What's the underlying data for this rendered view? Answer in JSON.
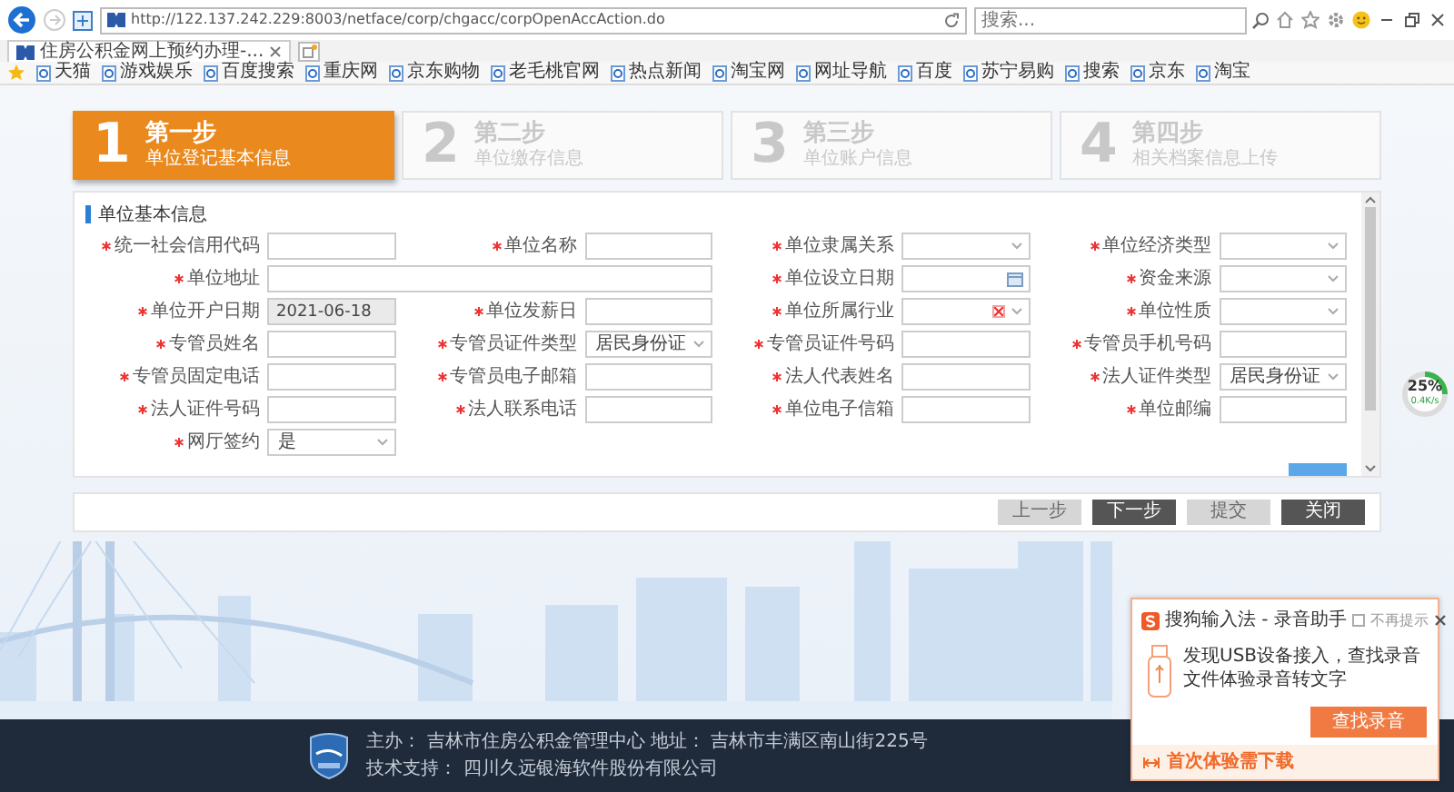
{
  "browser": {
    "address_bar": {
      "url": "http://122.137.242.229:8003/netface/corp/chgacc/corpOpenAccAction.do"
    },
    "search": {
      "placeholder": "搜索..."
    },
    "tabs": [
      {
        "title": "住房公积金网上预约办理-...",
        "selected": true
      }
    ],
    "bookmarks": [
      "天猫",
      "游戏娱乐",
      "百度搜索",
      "重庆网",
      "京东购物",
      "老毛桃官网",
      "热点新闻",
      "淘宝网",
      "网址导航",
      "百度",
      "苏宁易购",
      "搜索",
      "京东",
      "淘宝"
    ]
  },
  "steps": [
    {
      "number": "1",
      "title": "第一步",
      "subtitle": "单位登记基本信息",
      "selected": true
    },
    {
      "number": "2",
      "title": "第二步",
      "subtitle": "单位缴存信息",
      "selected": false
    },
    {
      "number": "3",
      "title": "第三步",
      "subtitle": "单位账户信息",
      "selected": false
    },
    {
      "number": "4",
      "title": "第四步",
      "subtitle": "相关档案信息上传",
      "selected": false
    }
  ],
  "form": {
    "section_title": "单位基本信息",
    "fields": [
      {
        "label": "统一社会信用代码",
        "required": true,
        "kind": "text"
      },
      {
        "label": "单位名称",
        "required": true,
        "kind": "text"
      },
      {
        "label": "单位隶属关系",
        "required": true,
        "kind": "select"
      },
      {
        "label": "单位经济类型",
        "required": true,
        "kind": "select"
      },
      {
        "label": "单位地址",
        "required": true,
        "kind": "text",
        "wide": true
      },
      {
        "label": "单位设立日期",
        "required": true,
        "kind": "date"
      },
      {
        "label": "资金来源",
        "required": true,
        "kind": "select"
      },
      {
        "label": "单位开户日期",
        "required": true,
        "kind": "text",
        "value": "2021-06-18",
        "disabled": true
      },
      {
        "label": "单位发薪日",
        "required": true,
        "kind": "text"
      },
      {
        "label": "单位所属行业",
        "required": true,
        "kind": "select",
        "clearable": true
      },
      {
        "label": "单位性质",
        "required": true,
        "kind": "select"
      },
      {
        "label": "专管员姓名",
        "required": true,
        "kind": "text"
      },
      {
        "label": "专管员证件类型",
        "required": true,
        "kind": "select",
        "value": "居民身份证"
      },
      {
        "label": "专管员证件号码",
        "required": true,
        "kind": "text"
      },
      {
        "label": "专管员手机号码",
        "required": true,
        "kind": "text"
      },
      {
        "label": "专管员固定电话",
        "required": true,
        "kind": "text"
      },
      {
        "label": "专管员电子邮箱",
        "required": true,
        "kind": "text"
      },
      {
        "label": "法人代表姓名",
        "required": true,
        "kind": "text"
      },
      {
        "label": "法人证件类型",
        "required": true,
        "kind": "select",
        "value": "居民身份证"
      },
      {
        "label": "法人证件号码",
        "required": true,
        "kind": "text"
      },
      {
        "label": "法人联系电话",
        "required": true,
        "kind": "text"
      },
      {
        "label": "单位电子信箱",
        "required": true,
        "kind": "text"
      },
      {
        "label": "单位邮编",
        "required": true,
        "kind": "text"
      },
      {
        "label": "网厅签约",
        "required": true,
        "kind": "select",
        "value": "是"
      }
    ]
  },
  "buttons": [
    {
      "label": "上一步",
      "disabled": true
    },
    {
      "label": "下一步",
      "disabled": false
    },
    {
      "label": "提交",
      "disabled": true
    },
    {
      "label": "关闭",
      "disabled": false
    }
  ],
  "net_widget": {
    "percent": "25%",
    "speed": "0.4K/s"
  },
  "popup": {
    "title": "搜狗输入法 - 录音助手",
    "checkbox_label": "不再提示",
    "checked": false,
    "message": "发现USB设备接入，查找录音文件体验录音转文字",
    "action": "查找录音",
    "footer_link": "首次体验需下载"
  },
  "footer": {
    "lines": [
      "主办： 吉林市住房公积金管理中心 地址： 吉林市丰满区南山街225号",
      "技术支持： 四川久远银海软件股份有限公司"
    ]
  }
}
